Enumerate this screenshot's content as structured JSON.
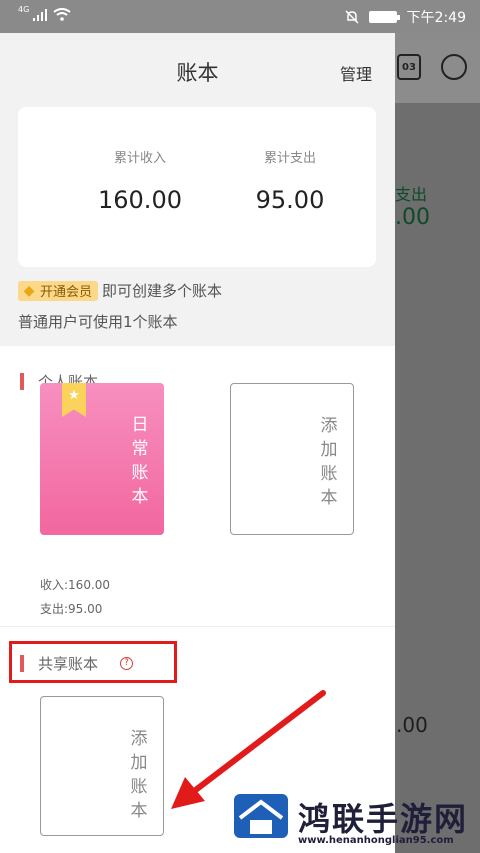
{
  "status_bar": {
    "network": "4G",
    "time": "下午2:49"
  },
  "background": {
    "calendar_day": "03",
    "expense_label": "支出",
    "expense_value": ".00",
    "bottom_value": ".00",
    "accent_color": "#0c4a2a"
  },
  "drawer": {
    "title": "账本",
    "manage_label": "管理",
    "summary": {
      "income_label": "累计收入",
      "income_value": "160.00",
      "expense_label": "累计支出",
      "expense_value": "95.00"
    },
    "vip": {
      "badge_label": "开通会员",
      "badge_text": "即可创建多个账本",
      "normal_note": "普通用户可使用1个账本"
    },
    "personal": {
      "section_title": "个人账本",
      "books": [
        {
          "name": "日常账本",
          "income_line": "收入:160.00",
          "expense_line": "支出:95.00",
          "color": "#f2679f"
        }
      ],
      "add_label": "添加账本"
    },
    "shared": {
      "section_title": "共享账本",
      "help_glyph": "?",
      "add_label": "添加账本"
    }
  },
  "annotation": {
    "highlight_color": "#e11a1a"
  },
  "watermark": {
    "title": "鸿联手游网",
    "url": "www.henanhonglian95.com"
  }
}
